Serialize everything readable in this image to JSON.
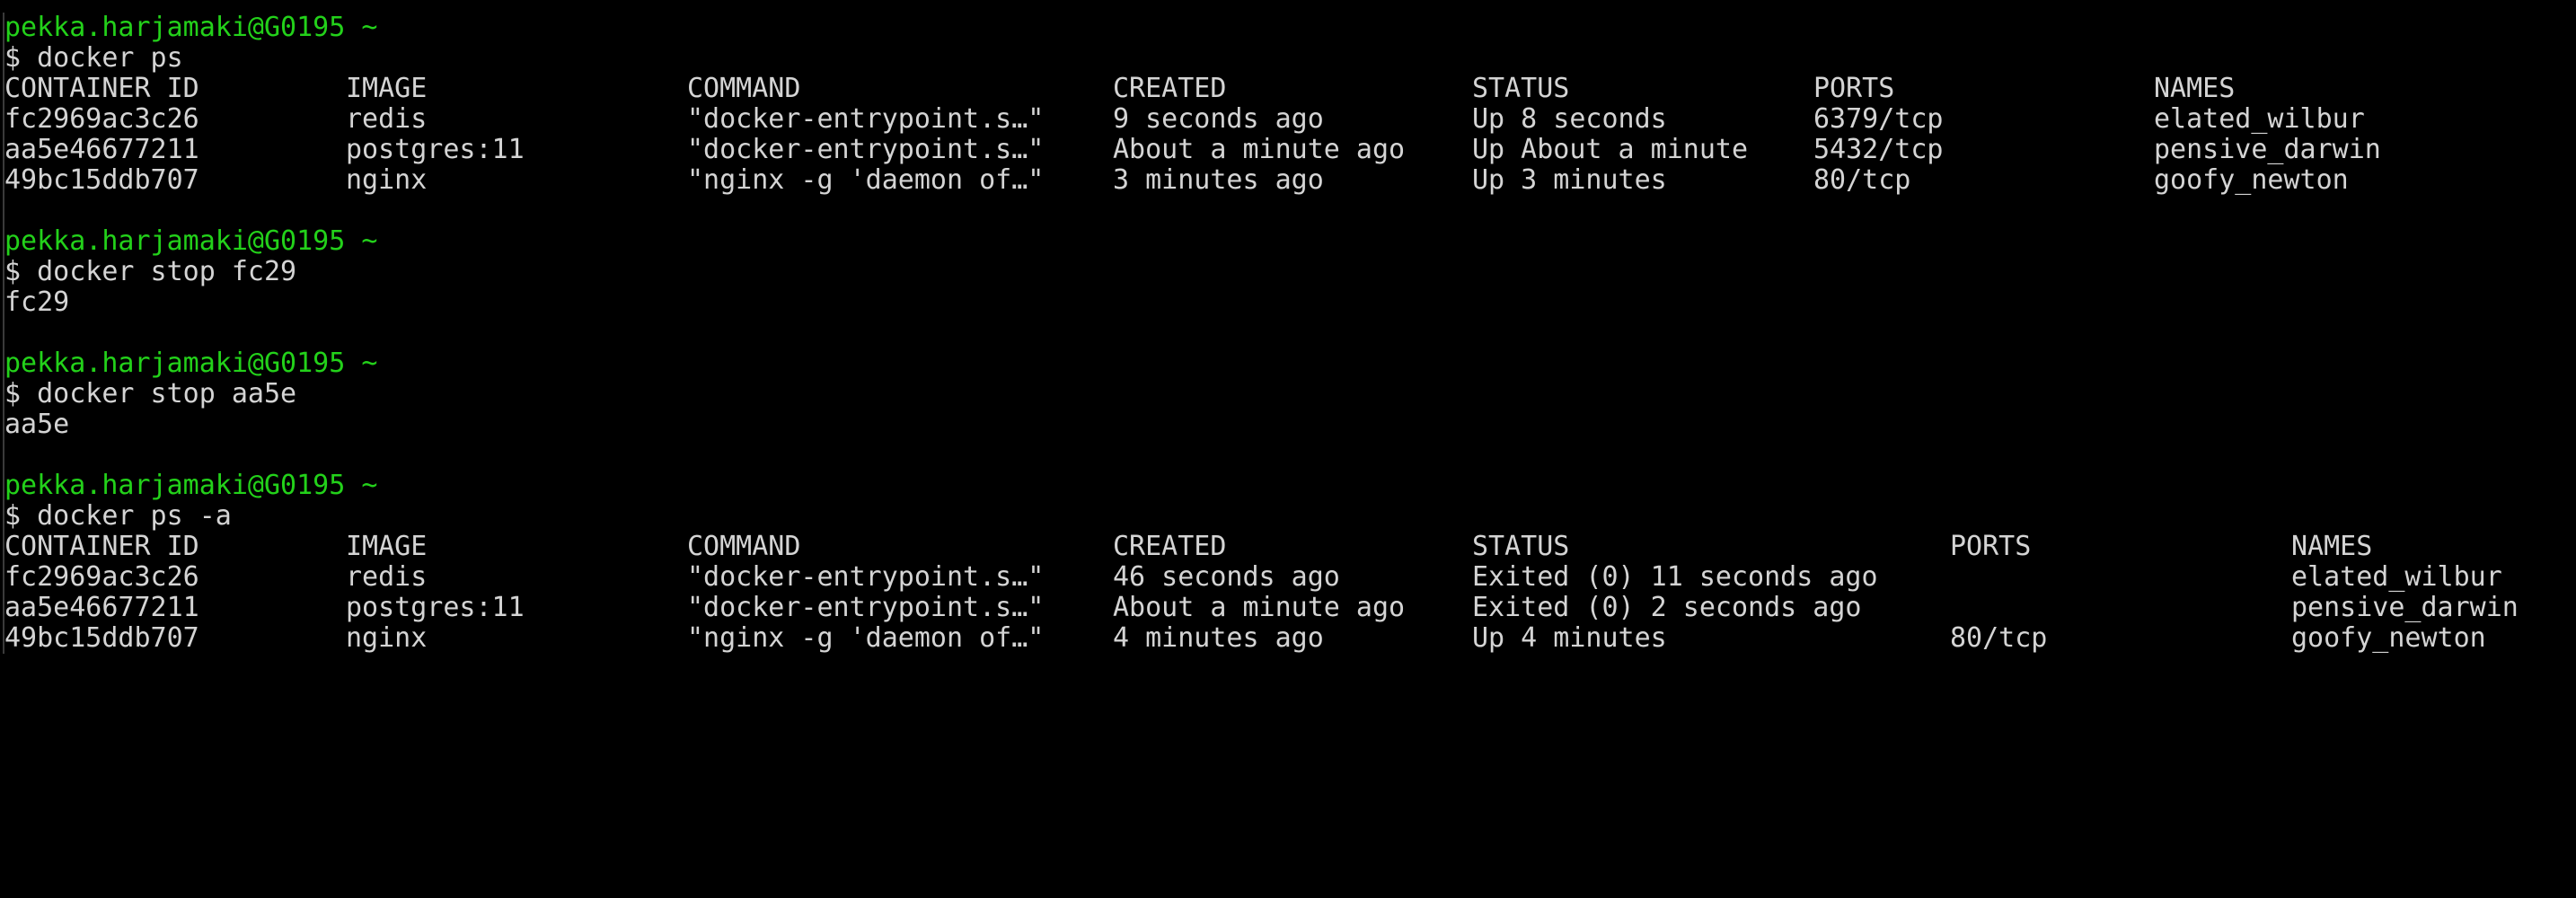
{
  "colors": {
    "background": "#000000",
    "text": "#d4d4d4",
    "prompt": "#23d11a"
  },
  "sessions": [
    {
      "prompt": "pekka.harjamaki@G0195 ~",
      "command": "$ docker ps"
    },
    {
      "prompt": "pekka.harjamaki@G0195 ~",
      "command": "$ docker stop fc29",
      "output": "fc29"
    },
    {
      "prompt": "pekka.harjamaki@G0195 ~",
      "command": "$ docker stop aa5e",
      "output": "aa5e"
    },
    {
      "prompt": "pekka.harjamaki@G0195 ~",
      "command": "$ docker ps -a"
    }
  ],
  "ps_table": {
    "headers": [
      "CONTAINER ID",
      "IMAGE",
      "COMMAND",
      "CREATED",
      "STATUS",
      "PORTS",
      "NAMES"
    ],
    "rows": [
      [
        "fc2969ac3c26",
        "redis",
        "\"docker-entrypoint.s…\"",
        "9 seconds ago",
        "Up 8 seconds",
        "6379/tcp",
        "elated_wilbur"
      ],
      [
        "aa5e46677211",
        "postgres:11",
        "\"docker-entrypoint.s…\"",
        "About a minute ago",
        "Up About a minute",
        "5432/tcp",
        "pensive_darwin"
      ],
      [
        "49bc15ddb707",
        "nginx",
        "\"nginx -g 'daemon of…\"",
        "3 minutes ago",
        "Up 3 minutes",
        "80/tcp",
        "goofy_newton"
      ]
    ]
  },
  "ps_a_table": {
    "headers": [
      "CONTAINER ID",
      "IMAGE",
      "COMMAND",
      "CREATED",
      "STATUS",
      "PORTS",
      "NAMES"
    ],
    "rows": [
      [
        "fc2969ac3c26",
        "redis",
        "\"docker-entrypoint.s…\"",
        "46 seconds ago",
        "Exited (0) 11 seconds ago",
        "",
        "elated_wilbur"
      ],
      [
        "aa5e46677211",
        "postgres:11",
        "\"docker-entrypoint.s…\"",
        "About a minute ago",
        "Exited (0) 2 seconds ago",
        "",
        "pensive_darwin"
      ],
      [
        "49bc15ddb707",
        "nginx",
        "\"nginx -g 'daemon of…\"",
        "4 minutes ago",
        "Up 4 minutes",
        "80/tcp",
        "goofy_newton"
      ]
    ]
  }
}
